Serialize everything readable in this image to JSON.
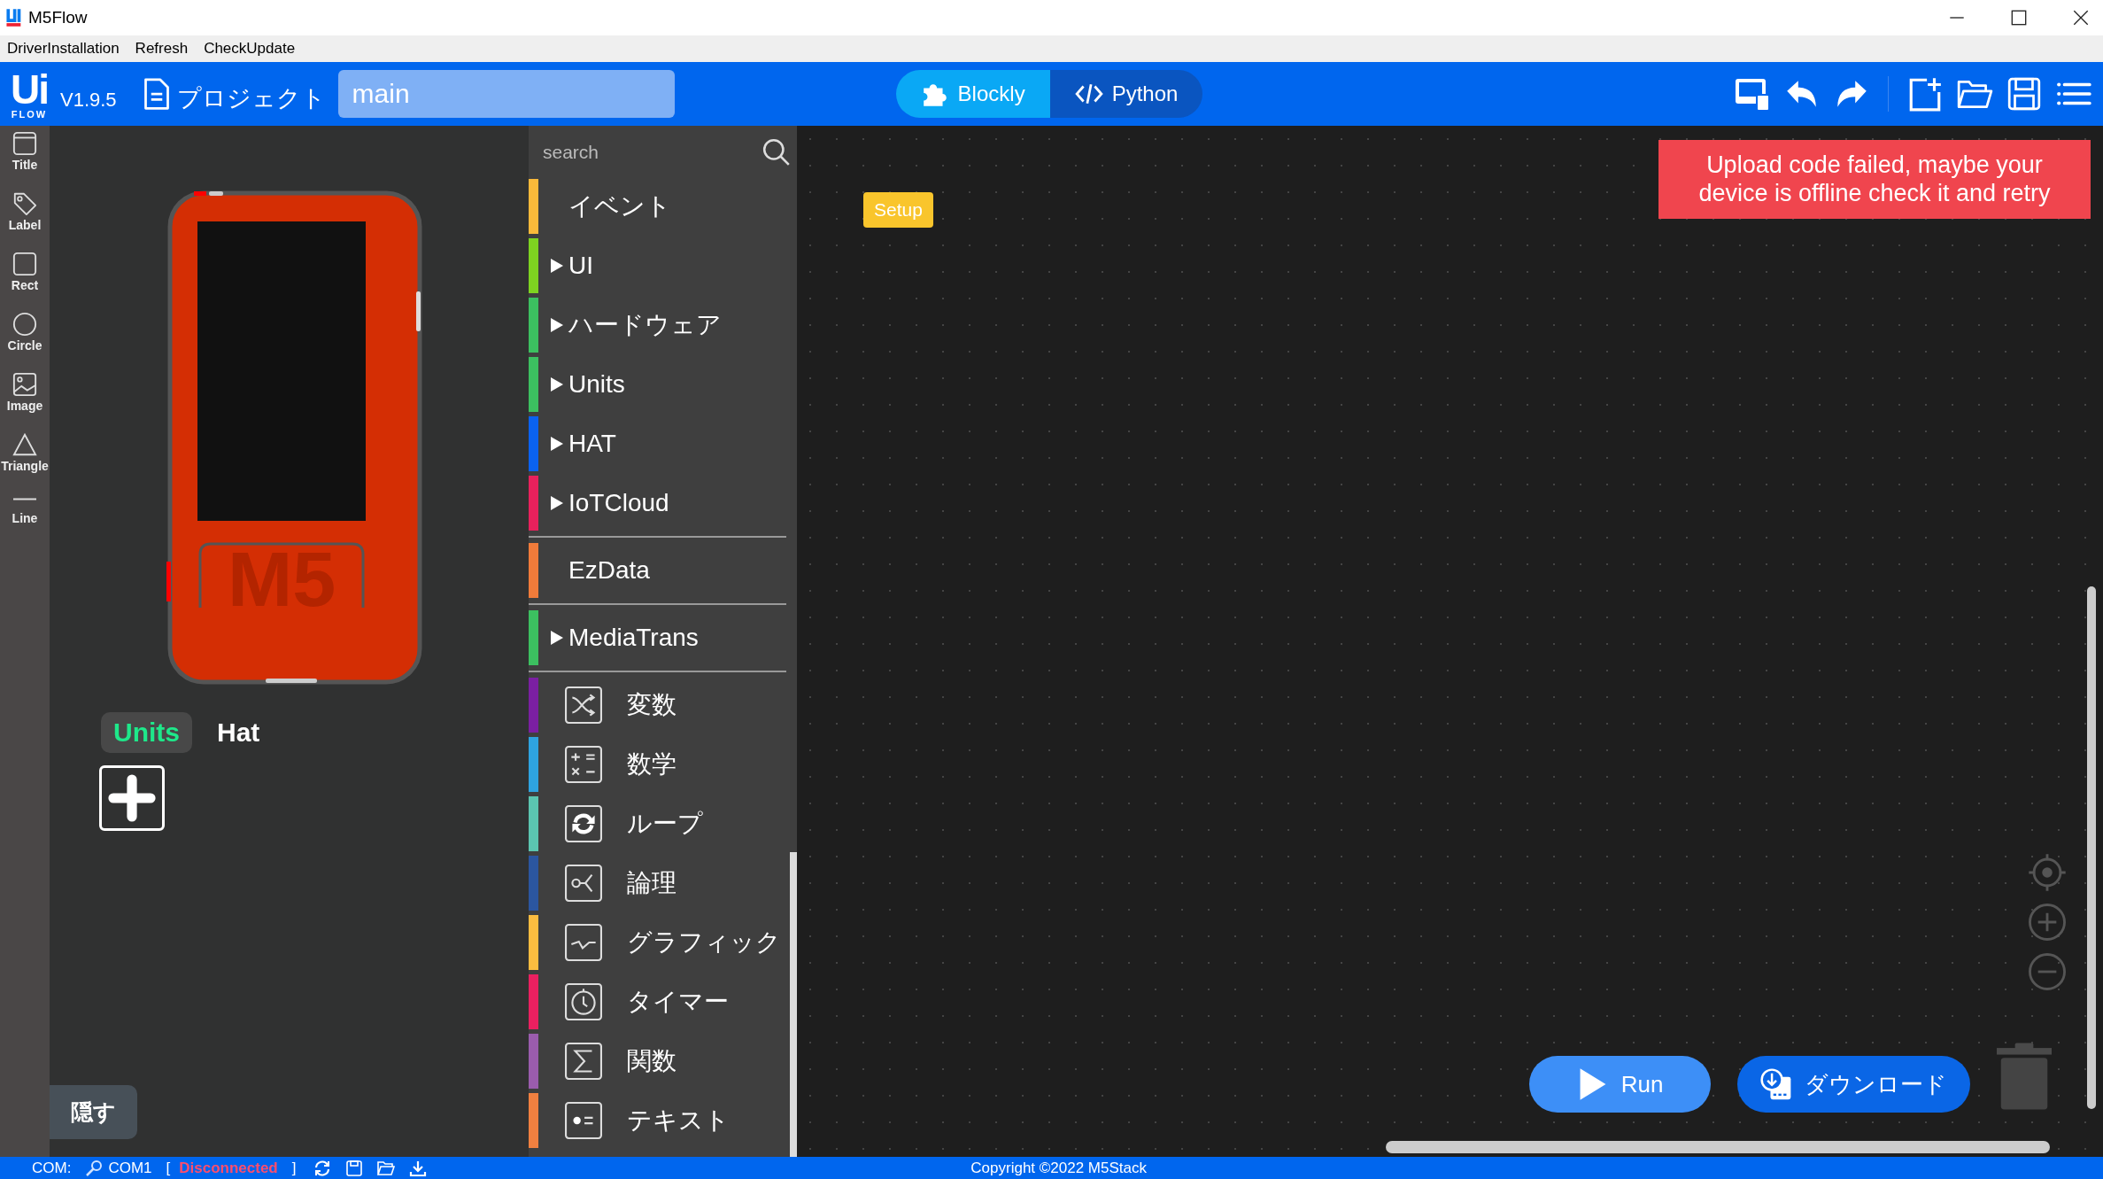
{
  "window": {
    "title": "M5Flow"
  },
  "menu": [
    "DriverInstallation",
    "Refresh",
    "CheckUpdate"
  ],
  "header": {
    "logo_top": "Ui",
    "logo_bottom": "FLOW",
    "version": "V1.9.5",
    "project_label": "プロジェクト",
    "file_name": "main",
    "modes": [
      {
        "label": "Blockly",
        "kind": "puzzle",
        "selected": true
      },
      {
        "label": "Python",
        "kind": "code",
        "selected": false
      }
    ]
  },
  "tools": [
    {
      "label": "Title",
      "kind": "title"
    },
    {
      "label": "Label",
      "kind": "label"
    },
    {
      "label": "Rect",
      "kind": "rect"
    },
    {
      "label": "Circle",
      "kind": "circle"
    },
    {
      "label": "Image",
      "kind": "image"
    },
    {
      "label": "Triangle",
      "kind": "triangle"
    },
    {
      "label": "Line",
      "kind": "line"
    }
  ],
  "device": {
    "logo": "M5"
  },
  "device_tabs": [
    {
      "label": "Units",
      "selected": true
    },
    {
      "label": "Hat",
      "selected": false
    }
  ],
  "hide_button": "隠す",
  "palette": {
    "search_placeholder": "search",
    "sections": [
      [
        {
          "label": "イベント",
          "kind": "plain",
          "color": "#f9b93a"
        },
        {
          "label": "UI",
          "kind": "folder",
          "color": "#7ed321"
        },
        {
          "label": "ハードウェア",
          "kind": "folder",
          "color": "#3cc060"
        },
        {
          "label": "Units",
          "kind": "folder",
          "color": "#3cc060"
        },
        {
          "label": "HAT",
          "kind": "folder",
          "color": "#0a62f0"
        },
        {
          "label": "IoTCloud",
          "kind": "folder",
          "color": "#e8215c"
        }
      ],
      [
        {
          "label": "EzData",
          "kind": "plain",
          "color": "#f07b3a"
        }
      ],
      [
        {
          "label": "MediaTrans",
          "kind": "folder",
          "color": "#3cc060"
        }
      ],
      [
        {
          "label": "変数",
          "kind": "variable",
          "color": "#7b1fa2"
        },
        {
          "label": "数学",
          "kind": "math",
          "color": "#2ea3e0"
        },
        {
          "label": "ループ",
          "kind": "loop",
          "color": "#5bc5b0"
        },
        {
          "label": "論理",
          "kind": "logic",
          "color": "#2b56a0"
        },
        {
          "label": "グラフィック",
          "kind": "graphic",
          "color": "#fbbc40"
        },
        {
          "label": "タイマー",
          "kind": "timer",
          "color": "#ea2060"
        },
        {
          "label": "関数",
          "kind": "function",
          "color": "#9a5cad"
        },
        {
          "label": "テキスト",
          "kind": "text",
          "color": "#f08040"
        }
      ]
    ]
  },
  "workspace": {
    "block": "Setup",
    "toast": "Upload code failed, maybe your device is offline check it and retry",
    "run_button": "Run",
    "download_button": "ダウンロード"
  },
  "status_bar": {
    "com_label": "COM:",
    "port": "COM1",
    "bracket_open": "[",
    "connection": "Disconnected",
    "bracket_close": "]",
    "copyright": "Copyright ©2022 M5Stack"
  }
}
